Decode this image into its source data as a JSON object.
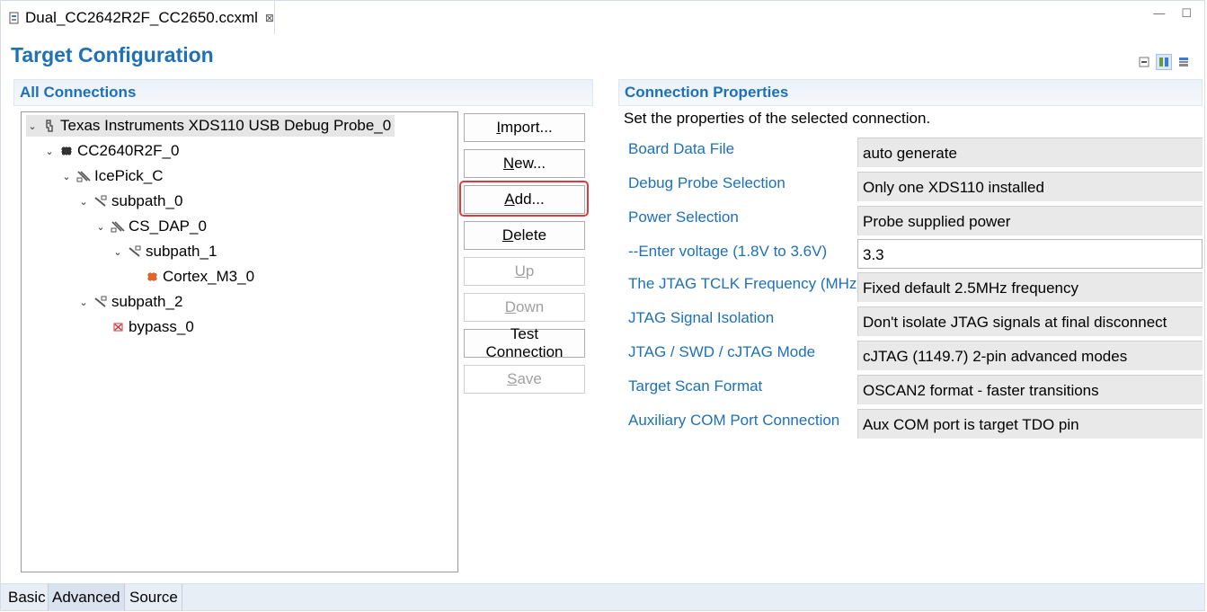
{
  "editor": {
    "tab_title": "Dual_CC2642R2F_CC2650.ccxml",
    "close_glyph": "⊠",
    "minimize_glyph": "—",
    "maximize_glyph": "☐"
  },
  "page": {
    "title": "Target Configuration"
  },
  "connections": {
    "header": "All Connections",
    "tree": [
      {
        "label": "Texas Instruments XDS110 USB Debug Probe_0",
        "icon": "debug-probe-icon",
        "expanded": true,
        "selected": true
      },
      {
        "label": "CC2640R2F_0",
        "icon": "chip-icon",
        "expanded": true
      },
      {
        "label": "IcePick_C",
        "icon": "router-icon",
        "expanded": true
      },
      {
        "label": "subpath_0",
        "icon": "subpath-icon",
        "expanded": true
      },
      {
        "label": "CS_DAP_0",
        "icon": "router-icon",
        "expanded": true
      },
      {
        "label": "subpath_1",
        "icon": "subpath-icon",
        "expanded": true
      },
      {
        "label": "Cortex_M3_0",
        "icon": "cpu-icon"
      },
      {
        "label": "subpath_2",
        "icon": "subpath-icon",
        "expanded": true
      },
      {
        "label": "bypass_0",
        "icon": "bypass-icon"
      }
    ]
  },
  "buttons": {
    "import": {
      "pre": "",
      "ul": "I",
      "post": "mport..."
    },
    "new": {
      "pre": "",
      "ul": "N",
      "post": "ew..."
    },
    "add": {
      "pre": "",
      "ul": "A",
      "post": "dd..."
    },
    "delete": {
      "pre": "",
      "ul": "D",
      "post": "elete"
    },
    "up": {
      "pre": "",
      "ul": "U",
      "post": "p"
    },
    "down": {
      "pre": "",
      "ul": "D",
      "post": "own"
    },
    "test": {
      "pre": "Test Connection",
      "ul": "",
      "post": ""
    },
    "save": {
      "pre": "",
      "ul": "S",
      "post": "ave"
    }
  },
  "properties": {
    "header": "Connection Properties",
    "description": "Set the properties of the selected connection.",
    "rows": [
      {
        "label": "Board Data File",
        "value": "auto generate"
      },
      {
        "label": "Debug Probe Selection",
        "value": "Only one XDS110 installed"
      },
      {
        "label": "Power Selection",
        "value": "Probe supplied power"
      },
      {
        "label": "--Enter voltage (1.8V to 3.6V)",
        "value": "3.3"
      },
      {
        "label": "The JTAG TCLK Frequency (MHz)",
        "value": "Fixed default 2.5MHz frequency"
      },
      {
        "label": "JTAG Signal Isolation",
        "value": "Don't isolate JTAG signals at final disconnect"
      },
      {
        "label": "JTAG / SWD / cJTAG Mode",
        "value": "cJTAG (1149.7) 2-pin advanced modes"
      },
      {
        "label": "Target Scan Format",
        "value": "OSCAN2 format - faster transitions"
      },
      {
        "label": "Auxiliary COM Port Connection",
        "value": "Aux COM port is target TDO pin"
      }
    ]
  },
  "bottom_tabs": [
    {
      "label": "Basic"
    },
    {
      "label": "Advanced",
      "active": true
    },
    {
      "label": "Source"
    }
  ],
  "colors": {
    "accent": "#1e70b8",
    "highlight": "#e0393e"
  }
}
